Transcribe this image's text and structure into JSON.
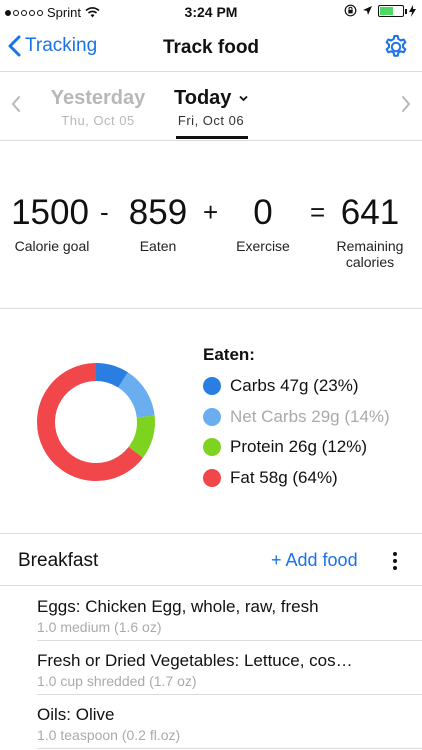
{
  "status_bar": {
    "carrier": "Sprint",
    "time": "3:24 PM",
    "signal_bars": 1
  },
  "navbar": {
    "back_label": "Tracking",
    "title": "Track food"
  },
  "days": {
    "previous": {
      "name": "Yesterday",
      "date": "Thu, Oct 05"
    },
    "current": {
      "name": "Today",
      "date": "Fri, Oct 06"
    }
  },
  "calories": {
    "goal": {
      "value": "1500",
      "label": "Calorie goal"
    },
    "op_minus": "-",
    "eaten": {
      "value": "859",
      "label": "Eaten"
    },
    "op_plus": "+",
    "exercise": {
      "value": "0",
      "label": "Exercise"
    },
    "op_equals": "=",
    "remaining": {
      "value": "641",
      "label_line1": "Remaining",
      "label_line2": "calories"
    }
  },
  "macros": {
    "title": "Eaten:",
    "items": [
      {
        "label": "Carbs 47g (23%)",
        "color": "#2a7de1",
        "percent": 23
      },
      {
        "label": "Net Carbs 29g (14%)",
        "color": "#6aaef0",
        "percent": 14
      },
      {
        "label": "Protein 26g (12%)",
        "color": "#7ed321",
        "percent": 12
      },
      {
        "label": "Fat 58g (64%)",
        "color": "#f2474a",
        "percent": 64
      }
    ]
  },
  "meal": {
    "title": "Breakfast",
    "add_label": "+ Add food",
    "foods": [
      {
        "name": "Eggs: Chicken Egg, whole, raw, fresh",
        "serving": "1.0 medium (1.6 oz)"
      },
      {
        "name": "Fresh or Dried Vegetables: Lettuce, cos…",
        "serving": "1.0 cup shredded (1.7 oz)"
      },
      {
        "name": "Oils: Olive",
        "serving": "1.0 teaspoon (0.2 fl.oz)"
      }
    ]
  },
  "colors": {
    "accent": "#1a73e8",
    "divider": "#dcdcdc",
    "muted": "#aaaaaa"
  }
}
